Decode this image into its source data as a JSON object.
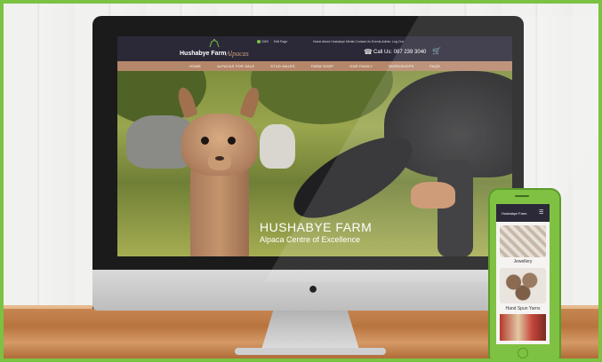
{
  "site": {
    "logo_primary": "Hushabye Farm",
    "logo_secondary": "Alpacas",
    "cms_link": "CMS",
    "edit_link": "Edit Page",
    "top_links": "Home  About Hushabye  Media  Contact Us  Events  Admin: Log Out",
    "phone": "Call Us: 087 239 3040",
    "nav": [
      "HOME",
      "ALPACAS FOR SALE",
      "STUD MALES",
      "FARM SHOP",
      "OUR FAMILY",
      "WORKSHOPS",
      "FAQS"
    ],
    "hero_title": "HUSHABYE FARM",
    "hero_subtitle": "Alpaca Centre of Excellence"
  },
  "mobile": {
    "logo": "Hushabye Farm",
    "category_1": "Jewellery",
    "category_2": "Hand Spun Yarns"
  },
  "colors": {
    "frame_border": "#7cc242",
    "nav_bar": "#b5876a",
    "header_bg": "#2b2838",
    "phone_body": "#7fc243"
  }
}
